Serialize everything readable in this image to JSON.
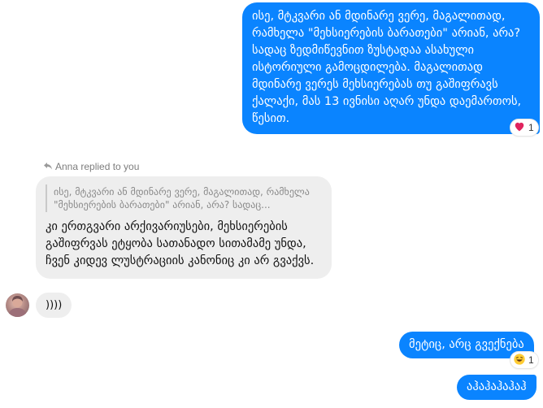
{
  "messages": {
    "outgoing_1": {
      "text": "ისე, მტკვარი ან მდინარე ვერე, მაგალითად, რამხელა \"მეხსიერების ბარათები\" არიან, არა? სადაც ზედმიწევნით ზუსტადაა ასახული ისტორიული გამოცდილება. მაგალითად მდინარე ვერეს მეხსიერებას თუ გაშიფრავს ქალაქი, მას 13 ივნისი აღარ უნდა დაემართოს, წესით.",
      "reaction": {
        "icon": "heart-icon",
        "count": "1",
        "color": "#e0245e"
      }
    },
    "incoming_reply": {
      "replied_label": "Anna replied to you",
      "quoted_text": "ისე, მტკვარი ან მდინარე ვერე, მაგალითად, რამხელა \"მეხსიერების ბარათები\" არიან, არა? სადაც...",
      "text": "კი ერთგვარი არქივარიუსები, მეხსიერების გაშიფრვას ეტყობა სათანადო სითამამე უნდა, ჩვენ კიდევ ლუსტრაციის კანონიც კი არ გვაქვს."
    },
    "incoming_2": {
      "text": "))))"
    },
    "outgoing_2": {
      "text": "მეტიც, არც გვექნება",
      "reaction": {
        "icon": "laughing-emoji-icon",
        "count": "1"
      }
    },
    "outgoing_3": {
      "text": "აჰაჰაჰაჰაჰ"
    }
  },
  "colors": {
    "outgoing_bubble": "#0a84ff",
    "incoming_bubble": "#eeeeee"
  }
}
